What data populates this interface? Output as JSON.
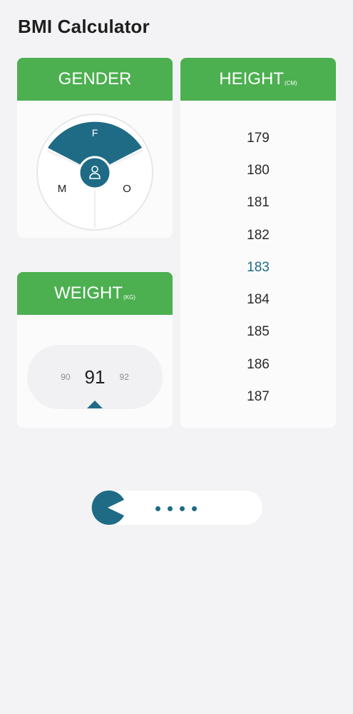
{
  "app": {
    "title": "BMI Calculator"
  },
  "colors": {
    "accent_green": "#4caf50",
    "primary_blue": "#1f6b86",
    "background": "#f3f3f5"
  },
  "gender": {
    "header": "GENDER",
    "options": {
      "female": "F",
      "male": "M",
      "other": "O"
    },
    "selected": "F",
    "center_icon": "person-icon"
  },
  "height": {
    "header": "HEIGHT",
    "unit": "(CM)",
    "values": [
      "179",
      "180",
      "181",
      "182",
      "183",
      "184",
      "185",
      "186",
      "187"
    ],
    "selected": "183"
  },
  "weight": {
    "header": "WEIGHT",
    "unit": "(KG)",
    "prev": "90",
    "current": "91",
    "next": "92"
  },
  "loader": {
    "icon": "pacman-icon",
    "dot_count": 4
  }
}
